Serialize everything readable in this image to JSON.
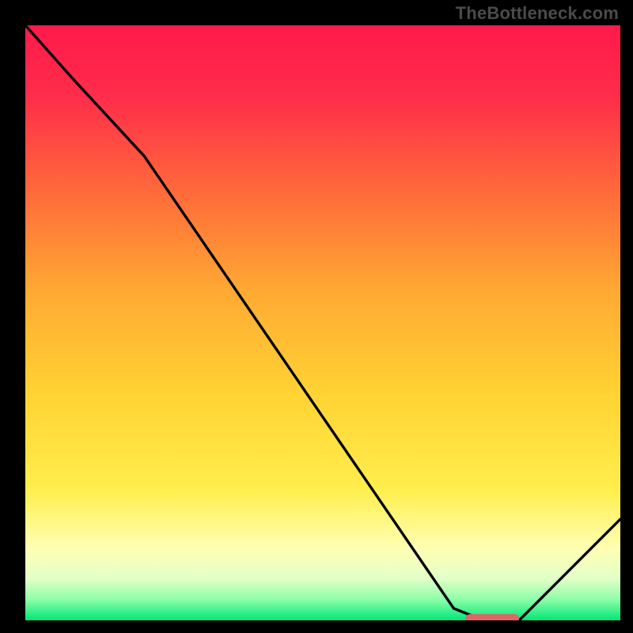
{
  "attribution": "TheBottleneck.com",
  "colors": {
    "gradient_stops": [
      {
        "offset": 0.0,
        "color": "#ff1a4a"
      },
      {
        "offset": 0.12,
        "color": "#ff2d4a"
      },
      {
        "offset": 0.28,
        "color": "#ff6a3a"
      },
      {
        "offset": 0.45,
        "color": "#ffaa33"
      },
      {
        "offset": 0.62,
        "color": "#ffd333"
      },
      {
        "offset": 0.78,
        "color": "#ffee4d"
      },
      {
        "offset": 0.88,
        "color": "#ffffb3"
      },
      {
        "offset": 0.93,
        "color": "#e2ffc8"
      },
      {
        "offset": 0.965,
        "color": "#8dffa8"
      },
      {
        "offset": 1.0,
        "color": "#00e676"
      }
    ],
    "curve": "#000000",
    "marker": "#e06666",
    "frame_bg": "#000000"
  },
  "chart_data": {
    "type": "line",
    "title": "",
    "xlabel": "",
    "ylabel": "",
    "xlim": [
      0,
      100
    ],
    "ylim": [
      0,
      100
    ],
    "x": [
      0,
      8,
      20,
      72,
      77,
      83,
      100
    ],
    "series": [
      {
        "name": "bottleneck-curve",
        "values": [
          100,
          91,
          78,
          2,
          0,
          0,
          17
        ]
      }
    ],
    "marker": {
      "x_start": 74,
      "x_end": 83,
      "y": 0.3,
      "thickness": 1.5
    },
    "grid": false,
    "legend": false
  }
}
